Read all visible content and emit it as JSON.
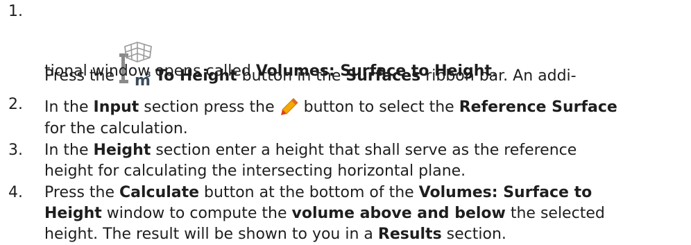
{
  "steps": [
    {
      "number": "1.",
      "segments": {
        "s1": "Press the ",
        "icon": "to-height-icon",
        "b1": "To Height",
        "s2": " button in the ",
        "b2": "Surfaces",
        "s3": " ribbon bar. An addi-",
        "s4": "tional window opens called ",
        "b3": "Volumes: Surface to Height",
        "s5": "."
      }
    },
    {
      "number": "2.",
      "segments": {
        "s1": "In the ",
        "b1": "Input",
        "s2": " section press the ",
        "icon": "pencil-icon",
        "s3": " button to select the ",
        "b2": "Reference Surface",
        "s4": "for the calculation."
      }
    },
    {
      "number": "3.",
      "segments": {
        "s1": "In the ",
        "b1": "Height",
        "s2": " section enter a height that shall serve as the reference",
        "s3": "height for calculating the intersecting horizontal plane."
      }
    },
    {
      "number": "4.",
      "segments": {
        "s1": "Press the ",
        "b1": "Calculate",
        "s2": " button at the bottom of the ",
        "b2": "Volumes: Surface to",
        "b3": "Height",
        "s3": " window to compute the ",
        "b4": "volume above and below",
        "s4": " the selected",
        "s5": "height. The result will be shown to you in a ",
        "b5": "Results",
        "s6": " section."
      }
    }
  ],
  "icon_colors": {
    "to_height_frame": "#8a8a8a",
    "to_height_unit": "#3a4a5a",
    "pencil_body": "#f4a800",
    "pencil_tip": "#e2401c"
  }
}
